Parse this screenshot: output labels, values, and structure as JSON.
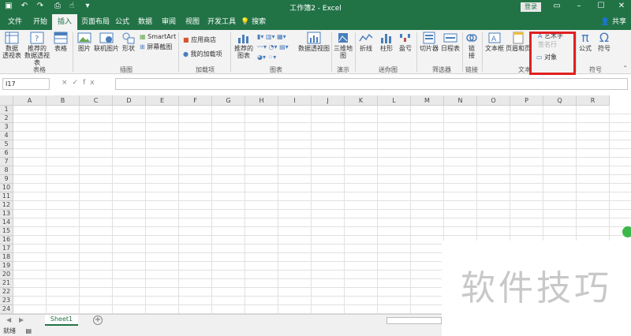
{
  "titlebar": {
    "title": "工作簿2 - Excel",
    "login": "登录",
    "qa_icons": [
      "save-icon",
      "undo-icon",
      "redo-icon",
      "print-preview-icon",
      "touch-mode-icon",
      "customize-icon"
    ],
    "window_buttons": [
      "minimize",
      "maximize",
      "close"
    ]
  },
  "tabs": [
    "文件",
    "开始",
    "插入",
    "页面布局",
    "公式",
    "数据",
    "审阅",
    "视图",
    "开发工具"
  ],
  "active_tab": "插入",
  "search_label": "搜索",
  "share_label": "共享",
  "ribbon": {
    "pivot_table": "数据\n透视表",
    "recommended_pivot": "推荐的\n数据透视表",
    "table": "表格",
    "group_tables": "表格",
    "picture": "图片",
    "online_picture": "联机图片",
    "shapes": "形状",
    "smartart": "SmartArt",
    "screenshot": "屏幕截图",
    "group_illustrations": "插图",
    "store": "应用商店",
    "my_addins": "我的加载项",
    "group_addins": "加载项",
    "recommended_charts": "推荐的\n图表",
    "pivot_chart": "数据透视图",
    "group_charts": "图表",
    "map_3d": "三维地\n图",
    "group_tours": "演示",
    "sparkline_line": "折线",
    "sparkline_column": "柱形",
    "sparkline_winloss": "盈亏",
    "group_sparklines": "迷你图",
    "slicer": "切片器",
    "timeline": "日程表",
    "group_filters": "筛选器",
    "link": "链\n接",
    "group_links": "链接",
    "textbox": "文本框",
    "header_footer": "页眉和页",
    "wordart": "艺术字",
    "signature": "签名行",
    "object": "对象",
    "group_text": "文本",
    "equation": "公式",
    "symbol": "符号",
    "group_symbols": "符号"
  },
  "formula_bar": {
    "cell_ref": "I17",
    "icons": [
      "×",
      "✓",
      "fx"
    ],
    "value": ""
  },
  "columns": [
    "A",
    "B",
    "C",
    "D",
    "E",
    "F",
    "G",
    "H",
    "I",
    "J",
    "K",
    "L",
    "M",
    "N",
    "O",
    "P",
    "Q",
    "R"
  ],
  "rows": [
    "1",
    "2",
    "3",
    "4",
    "5",
    "6",
    "7",
    "8",
    "9",
    "10",
    "11",
    "12",
    "13",
    "14",
    "15",
    "16",
    "17",
    "18",
    "19",
    "20",
    "21",
    "22",
    "23",
    "24"
  ],
  "sheet_tab": "Sheet1",
  "status": {
    "ready": "就绪"
  },
  "watermark": "软件技巧",
  "colors": {
    "accent": "#217346",
    "highlight": "#e02020"
  }
}
